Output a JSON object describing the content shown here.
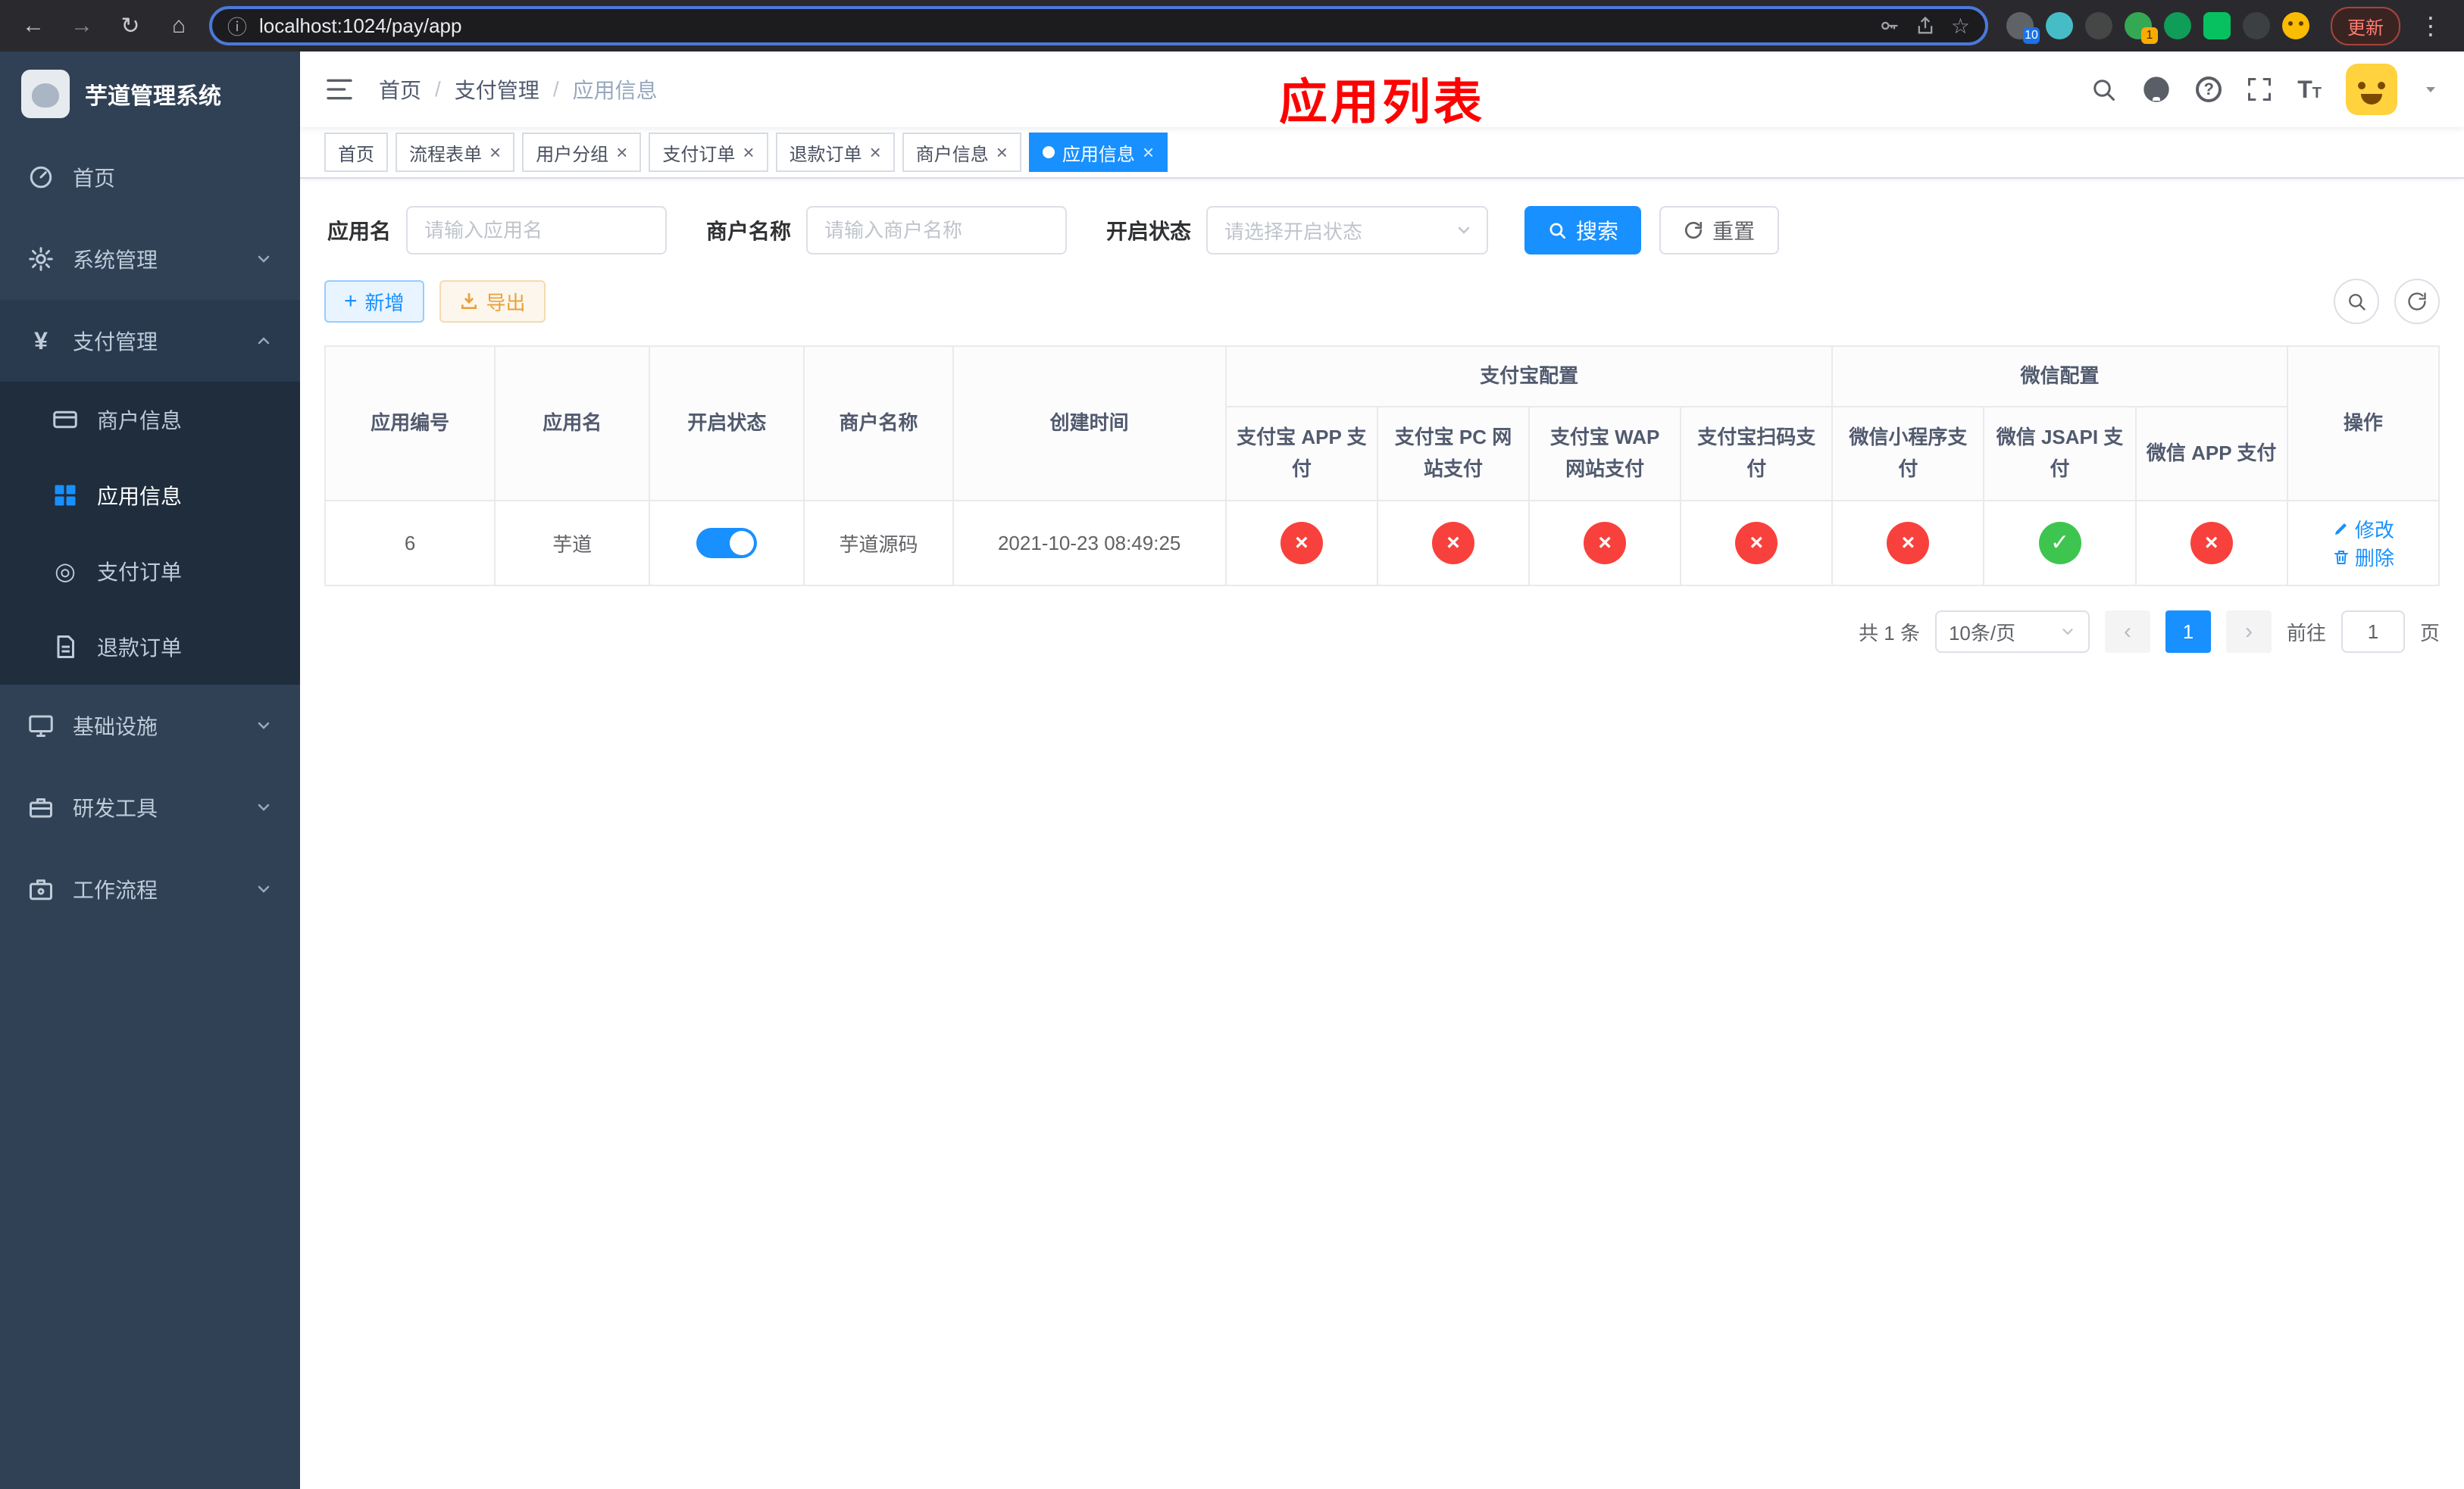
{
  "colors": {
    "accent": "#1890ff",
    "success": "#3dc550",
    "danger": "#f8413c"
  },
  "browser": {
    "url": "localhost:1024/pay/app",
    "update_label": "更新",
    "ext_badge_10": "10",
    "ext_badge_1": "1"
  },
  "sidebar": {
    "title": "芋道管理系统",
    "items": [
      {
        "label": "首页"
      },
      {
        "label": "系统管理"
      },
      {
        "label": "支付管理"
      },
      {
        "label": "基础设施"
      },
      {
        "label": "研发工具"
      },
      {
        "label": "工作流程"
      }
    ],
    "pay_submenu": [
      {
        "label": "商户信息"
      },
      {
        "label": "应用信息"
      },
      {
        "label": "支付订单"
      },
      {
        "label": "退款订单"
      }
    ]
  },
  "header": {
    "breadcrumb": [
      "首页",
      "支付管理",
      "应用信息"
    ],
    "overlay_title": "应用列表"
  },
  "tabs": [
    {
      "label": "首页"
    },
    {
      "label": "流程表单"
    },
    {
      "label": "用户分组"
    },
    {
      "label": "支付订单"
    },
    {
      "label": "退款订单"
    },
    {
      "label": "商户信息"
    },
    {
      "label": "应用信息"
    }
  ],
  "filters": {
    "app_name_label": "应用名",
    "app_name_placeholder": "请输入应用名",
    "merchant_label": "商户名称",
    "merchant_placeholder": "请输入商户名称",
    "status_label": "开启状态",
    "status_placeholder": "请选择开启状态",
    "search_label": "搜索",
    "reset_label": "重置"
  },
  "toolbar": {
    "add_label": "新增",
    "export_label": "导出"
  },
  "table": {
    "headers": {
      "app_id": "应用编号",
      "app_name": "应用名",
      "status": "开启状态",
      "merchant": "商户名称",
      "created": "创建时间",
      "alipay_group": "支付宝配置",
      "wechat_group": "微信配置",
      "actions": "操作",
      "alipay_cols": [
        "支付宝 APP 支付",
        "支付宝 PC 网站支付",
        "支付宝 WAP 网站支付",
        "支付宝扫码支付"
      ],
      "wechat_cols": [
        "微信小程序支付",
        "微信 JSAPI 支付",
        "微信 APP 支付"
      ]
    },
    "row": {
      "app_id": "6",
      "app_name": "芋道",
      "status_on": true,
      "merchant": "芋道源码",
      "created": "2021-10-23 08:49:25",
      "configs": [
        false,
        false,
        false,
        false,
        false,
        true,
        false
      ],
      "edit_label": "修改",
      "delete_label": "删除"
    }
  },
  "pagination": {
    "total": "共 1 条",
    "page_size": "10条/页",
    "page": "1",
    "goto": "前往",
    "goto_value": "1",
    "unit": "页"
  }
}
